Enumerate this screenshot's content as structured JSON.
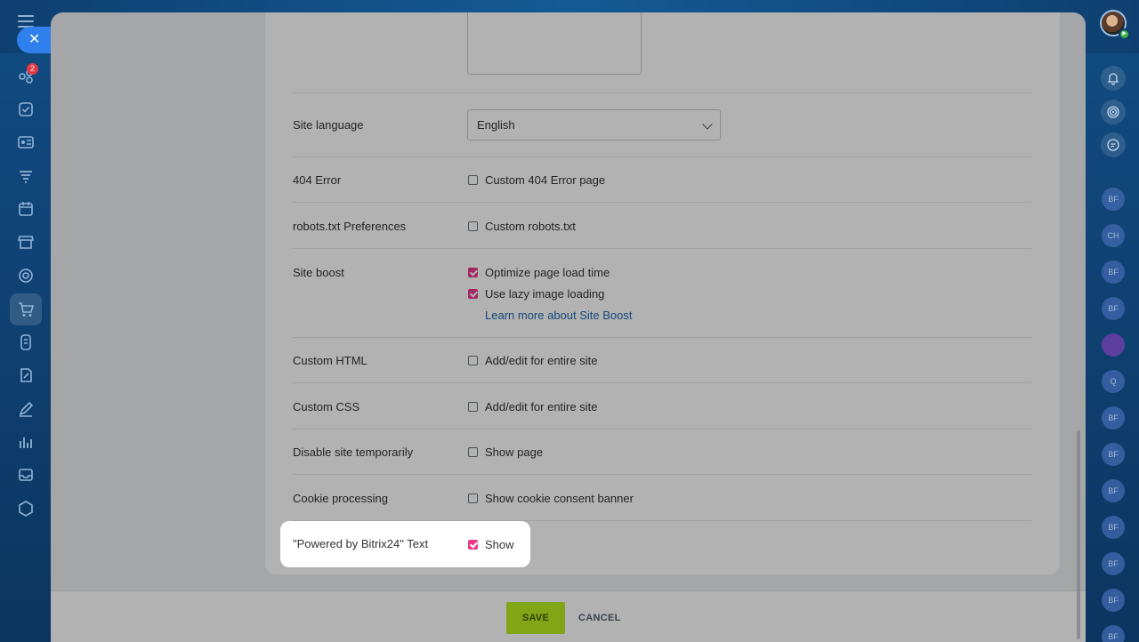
{
  "left_sidebar": {
    "badge_count": "2",
    "icons": [
      "chat-icon",
      "tasks-icon",
      "contact-center-icon",
      "crm-icon",
      "calendar-icon",
      "store-icon",
      "target-icon",
      "shopping-cart-icon",
      "documents-icon",
      "sign-icon",
      "pen-icon",
      "analytics-icon",
      "inbox-icon",
      "box-icon"
    ]
  },
  "close_button": {
    "label": "✕"
  },
  "right_sidebar": {
    "icons": [
      "bell-icon",
      "copilot-icon",
      "chat-bubble-icon"
    ],
    "avatars": [
      "BF",
      "CH",
      "BF",
      "BF",
      "",
      "Q",
      "BF",
      "BF",
      "BF",
      "BF",
      "BF",
      "BF",
      "BF"
    ]
  },
  "settings": {
    "site_language": {
      "label": "Site language",
      "value": "English"
    },
    "error_404": {
      "label": "404 Error",
      "option": "Custom 404 Error page",
      "checked": false
    },
    "robots": {
      "label": "robots.txt Preferences",
      "option": "Custom robots.txt",
      "checked": false
    },
    "site_boost": {
      "label": "Site boost",
      "options": [
        {
          "label": "Optimize page load time",
          "checked": true
        },
        {
          "label": "Use lazy image loading",
          "checked": true
        }
      ],
      "link": "Learn more about Site Boost"
    },
    "custom_html": {
      "label": "Custom HTML",
      "option": "Add/edit for entire site",
      "checked": false
    },
    "custom_css": {
      "label": "Custom CSS",
      "option": "Add/edit for entire site",
      "checked": false
    },
    "disable_site": {
      "label": "Disable site temporarily",
      "option": "Show page",
      "checked": false
    },
    "cookie": {
      "label": "Cookie processing",
      "option": "Show cookie consent banner",
      "checked": false
    },
    "powered_by": {
      "label": "\"Powered by Bitrix24\" Text",
      "option": "Show",
      "checked": true
    }
  },
  "footer": {
    "save_label": "SAVE",
    "cancel_label": "CANCEL"
  },
  "colors": {
    "accent_check": "#e93b8a",
    "save_button": "#bbed21",
    "link": "#2067b0"
  }
}
